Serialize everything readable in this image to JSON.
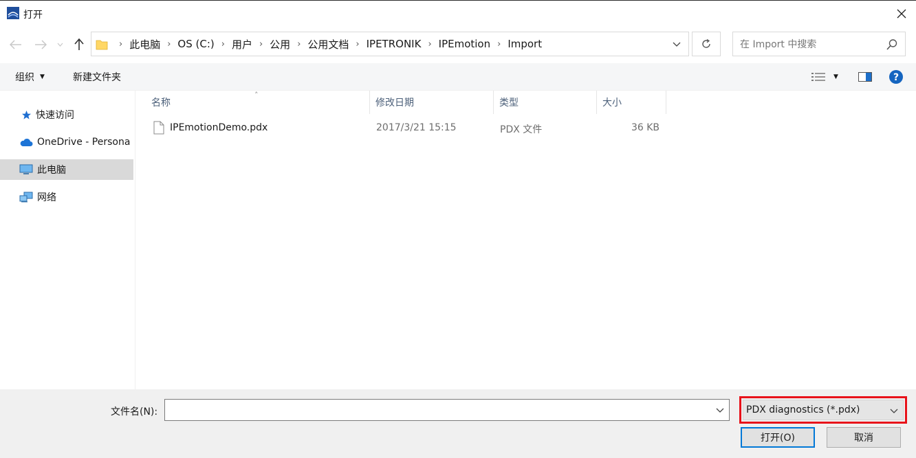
{
  "window": {
    "title": "打开"
  },
  "address": {
    "crumbs": [
      "此电脑",
      "OS (C:)",
      "用户",
      "公用",
      "公用文档",
      "IPETRONIK",
      "IPEmotion",
      "Import"
    ]
  },
  "search": {
    "placeholder": "在 Import 中搜索"
  },
  "toolbar": {
    "organize_label": "组织",
    "new_folder_label": "新建文件夹"
  },
  "sidebar": {
    "items": [
      {
        "label": "快速访问",
        "icon": "star-icon"
      },
      {
        "label": "OneDrive - Persona",
        "icon": "cloud-icon"
      },
      {
        "label": "此电脑",
        "icon": "computer-icon",
        "selected": true
      },
      {
        "label": "网络",
        "icon": "network-icon"
      }
    ]
  },
  "filelist": {
    "columns": {
      "name": "名称",
      "modified": "修改日期",
      "type": "类型",
      "size": "大小"
    },
    "rows": [
      {
        "name": "IPEmotionDemo.pdx",
        "modified": "2017/3/21 15:15",
        "type": "PDX 文件",
        "size": "36 KB"
      }
    ]
  },
  "bottom": {
    "filename_label": "文件名(N):",
    "filename_value": "",
    "filter_selected": "PDX diagnostics (*.pdx)",
    "open_label": "打开(O)",
    "cancel_label": "取消"
  },
  "colors": {
    "accent": "#0078d7",
    "highlight_border": "#e8121a",
    "selected_bg": "#d9d9d9"
  }
}
